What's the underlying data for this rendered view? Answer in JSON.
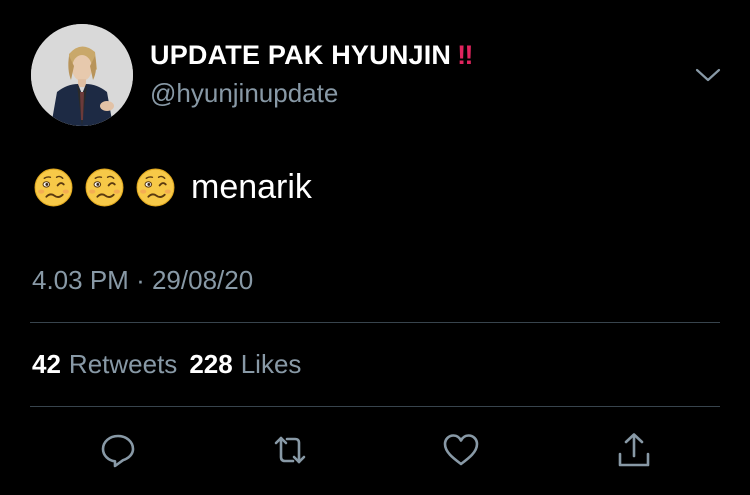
{
  "author": {
    "display_name": "UPDATE PAK HYUNJIN",
    "name_emoji": "‼",
    "handle": "@hyunjinupdate"
  },
  "tweet": {
    "emojis": [
      "woozy-face",
      "woozy-face",
      "woozy-face"
    ],
    "text": "menarik",
    "time": "4.03 PM",
    "separator": "·",
    "date": "29/08/20"
  },
  "stats": {
    "retweets_count": "42",
    "retweets_label": "Retweets",
    "likes_count": "228",
    "likes_label": "Likes"
  },
  "actions": [
    "reply-icon",
    "retweet-icon",
    "like-icon",
    "share-icon"
  ],
  "colors": {
    "background": "#000000",
    "text": "#ffffff",
    "secondary": "#8899a6",
    "divider": "#38444d",
    "accent_red": "#e0245e"
  }
}
